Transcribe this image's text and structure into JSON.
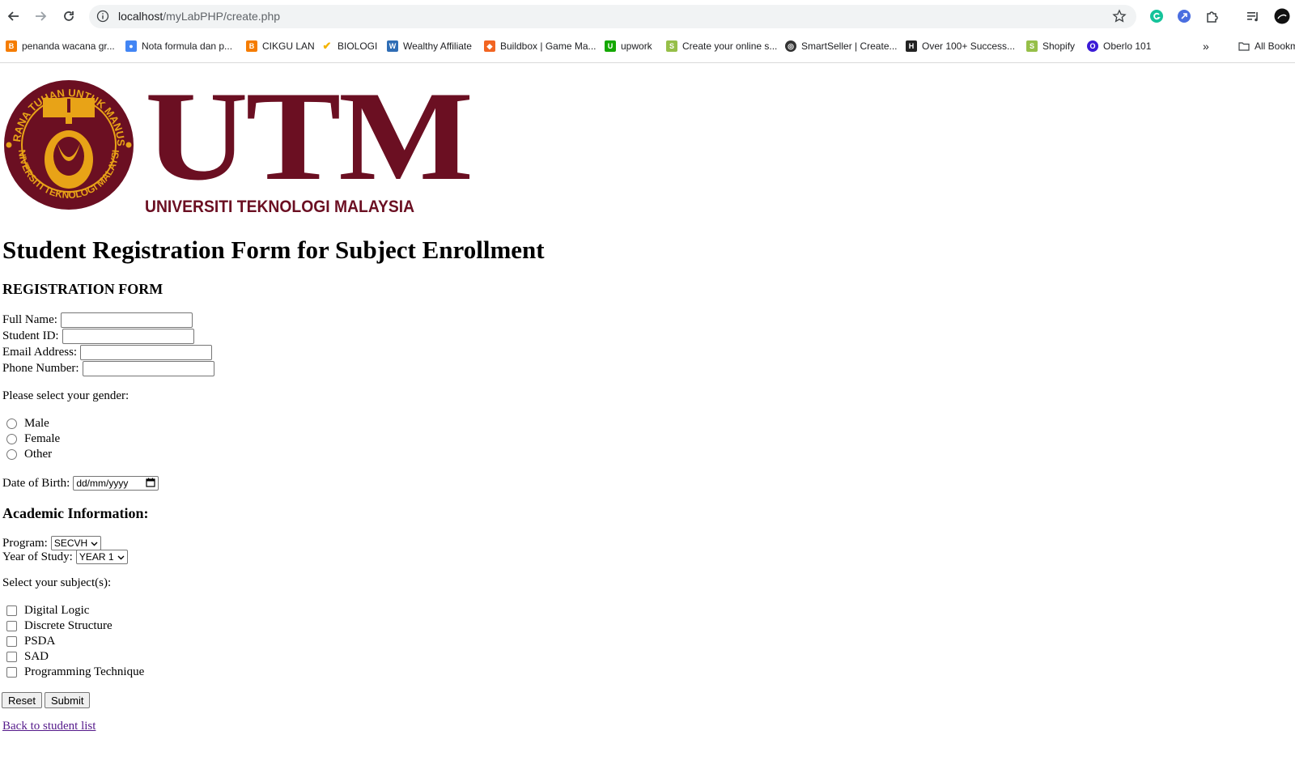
{
  "browser": {
    "url_host": "localhost",
    "url_path": "/myLabPHP/create.php",
    "bookmarks": [
      {
        "label": "penanda wacana gr...",
        "icon": "blogger-icon",
        "color": "#f57c00"
      },
      {
        "label": "Nota formula dan p...",
        "icon": "person-icon",
        "color": "#4285f4"
      },
      {
        "label": "CIKGU LAN",
        "icon": "blogger-icon",
        "color": "#f57c00"
      },
      {
        "label": "BIOLOGI",
        "icon": "check-icon",
        "color": "#f4b400"
      },
      {
        "label": "Wealthy Affiliate",
        "icon": "wa-icon",
        "color": "#2f6db5"
      },
      {
        "label": "Buildbox | Game Ma...",
        "icon": "buildbox-icon",
        "color": "#f26522"
      },
      {
        "label": "upwork",
        "icon": "upwork-icon",
        "color": "#14a800"
      },
      {
        "label": "Create your online s...",
        "icon": "shopify-icon",
        "color": "#96bf48"
      },
      {
        "label": "SmartSeller | Create...",
        "icon": "globe-icon",
        "color": "#333333"
      },
      {
        "label": "Over 100+ Success...",
        "icon": "h-icon",
        "color": "#222222"
      },
      {
        "label": "Shopify",
        "icon": "shopify-icon",
        "color": "#96bf48"
      },
      {
        "label": "Oberlo 101",
        "icon": "oberlo-icon",
        "color": "#3b1bd6"
      }
    ],
    "all_bookmarks": "All Bookmarks"
  },
  "logo": {
    "wordmark": "UTM",
    "subtitle": "UNIVERSITI TEKNOLOGI MALAYSIA",
    "seal_text": "KERANA TUHAN UNTUK MANUSIA · UNIVERSITI TEKNOLOGI MALAYSIA",
    "brand_color": "#6b0f22",
    "seal_gold": "#e8a317"
  },
  "page": {
    "title": "Student Registration Form for Subject Enrollment",
    "form_heading": "REGISTRATION FORM"
  },
  "fields": {
    "full_name": "Full Name:",
    "student_id": "Student ID:",
    "email": "Email Address:",
    "phone": "Phone Number:"
  },
  "gender": {
    "prompt": "Please select your gender:",
    "options": [
      "Male",
      "Female",
      "Other"
    ]
  },
  "dob": {
    "label": "Date of Birth:",
    "placeholder": "dd/mm/yyyy"
  },
  "academic": {
    "heading": "Academic Information:",
    "program_label": "Program:",
    "program_value": "SECVH",
    "year_label": "Year of Study:",
    "year_value": "YEAR 1"
  },
  "subjects": {
    "prompt": "Select your subject(s):",
    "options": [
      "Digital Logic",
      "Discrete Structure",
      "PSDA",
      "SAD",
      "Programming Technique"
    ]
  },
  "buttons": {
    "reset": "Reset",
    "submit": "Submit"
  },
  "back_link": "Back to student list"
}
